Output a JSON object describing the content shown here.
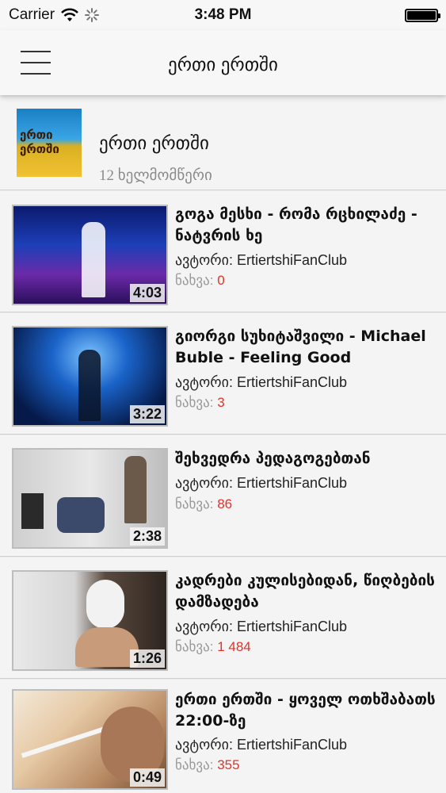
{
  "status_bar": {
    "carrier": "Carrier",
    "time": "3:48 PM",
    "icons": [
      "wifi-icon",
      "activity-spinner-icon",
      "battery-icon"
    ]
  },
  "nav": {
    "title": "ერთი ერთში",
    "menu_icon": "hamburger-menu-icon"
  },
  "channel": {
    "title": "ერთი ერთში",
    "subscribers": "12 ხელმომწერი",
    "logo_text": "ერთი ერთში"
  },
  "videos": [
    {
      "title": "გოგა მესხი - რომა რცხილაძე - ნატვრის ხე",
      "author_label": "ავტორი:",
      "author": "ErtiertshiFanClub",
      "views_label": "ნახვა:",
      "views": "0",
      "duration": "4:03"
    },
    {
      "title": "გიორგი სუხიტაშვილი - Michael Buble - Feeling Good",
      "author_label": "ავტორი:",
      "author": "ErtiertshiFanClub",
      "views_label": "ნახვა:",
      "views": "3",
      "duration": "3:22"
    },
    {
      "title": "შეხვედრა პედაგოგებთან",
      "author_label": "ავტორი:",
      "author": "ErtiertshiFanClub",
      "views_label": "ნახვა:",
      "views": "86",
      "duration": "2:38"
    },
    {
      "title": "კადრები კულისებიდან, წიღბების დამზადება",
      "author_label": "ავტორი:",
      "author": "ErtiertshiFanClub",
      "views_label": "ნახვა:",
      "views": "1 484",
      "duration": "1:26"
    },
    {
      "title": "ერთი ერთში - ყოველ ოთხშაბათს 22:00-ზე",
      "author_label": "ავტორი:",
      "author": "ErtiertshiFanClub",
      "views_label": "ნახვა:",
      "views": "355",
      "duration": "0:49"
    }
  ],
  "colors": {
    "background": "#f4f4f4",
    "views_count": "#e0332b",
    "secondary_text": "#999999"
  }
}
